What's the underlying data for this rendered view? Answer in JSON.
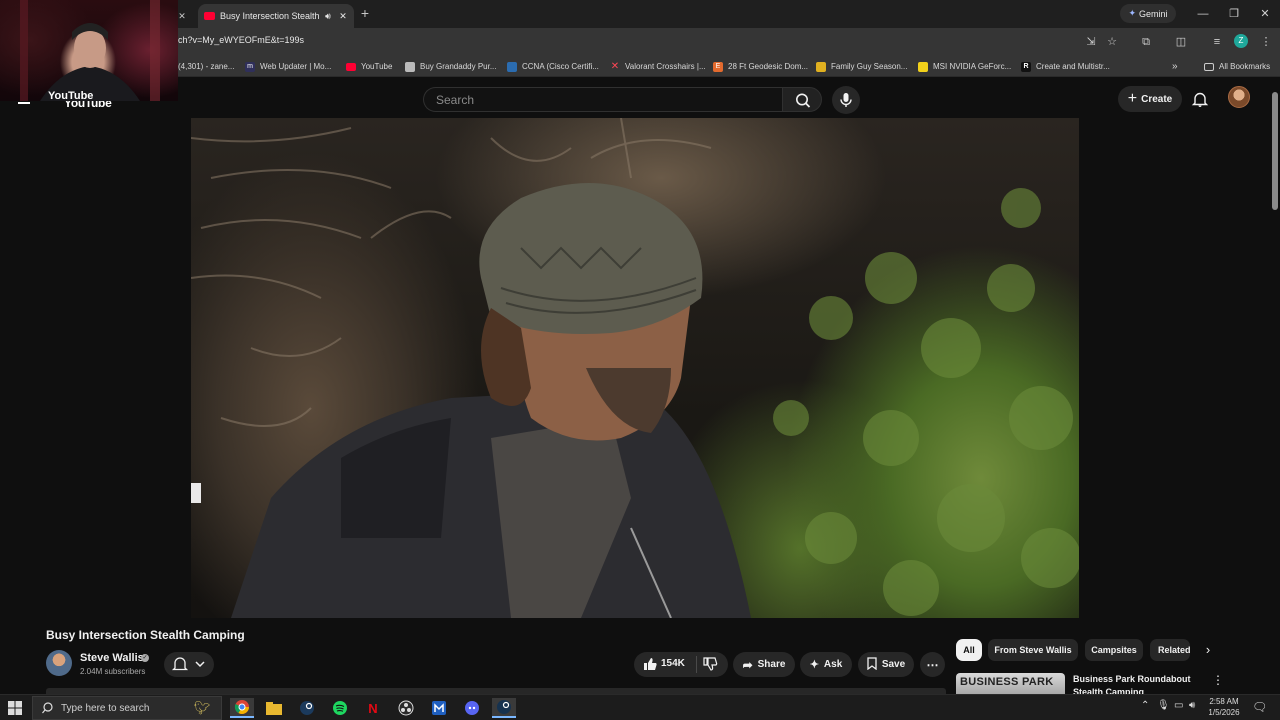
{
  "browser": {
    "active_tab_title": "Busy Intersection Stealth Ca",
    "url": "ch?v=My_eWYEOFmE&t=199s",
    "gemini_label": "Gemini",
    "bookmarks": [
      {
        "label": "(4,301) - zane...",
        "icon": "tab-icon",
        "color": "#555555"
      },
      {
        "label": "Web Updater | Mo...",
        "icon": "web-updater-icon",
        "color": "#444466"
      },
      {
        "label": "YouTube",
        "icon": "youtube-icon",
        "color": "#ff0033"
      },
      {
        "label": "Buy Grandaddy Pur...",
        "icon": "page-icon",
        "color": "#888888"
      },
      {
        "label": "CCNA (Cisco Certifi...",
        "icon": "page-icon",
        "color": "#2b6cb0"
      },
      {
        "label": "Valorant Crosshairs |...",
        "icon": "valorant-icon",
        "color": "#ff4655"
      },
      {
        "label": "28 Ft Geodesic Dom...",
        "icon": "geodesic-icon",
        "color": "#e36a2e"
      },
      {
        "label": "Family Guy Season...",
        "icon": "folder-image-icon",
        "color": "#e0b020"
      },
      {
        "label": "MSI NVIDIA GeForc...",
        "icon": "msi-icon",
        "color": "#f2d11b"
      },
      {
        "label": "Create and Multistr...",
        "icon": "restream-icon",
        "color": "#ffffff"
      }
    ],
    "all_bookmarks_label": "All Bookmarks"
  },
  "youtube": {
    "logo_text": "YouTube",
    "search_placeholder": "Search",
    "create_label": "Create",
    "video_title": "Busy Intersection Stealth Camping",
    "channel_name": "Steve Wallis",
    "subscribers": "2.04M subscribers",
    "like_count": "154K",
    "share_label": "Share",
    "ask_label": "Ask",
    "save_label": "Save",
    "chips": [
      "All",
      "From Steve Wallis",
      "Campsites",
      "Related"
    ],
    "recommendation": {
      "thumb_text": "BUSINESS PARK",
      "title": "Business Park Roundabout Stealth Camping"
    }
  },
  "taskbar": {
    "search_placeholder": "Type here to search",
    "time": "2:58 AM",
    "date": "1/5/2026"
  }
}
